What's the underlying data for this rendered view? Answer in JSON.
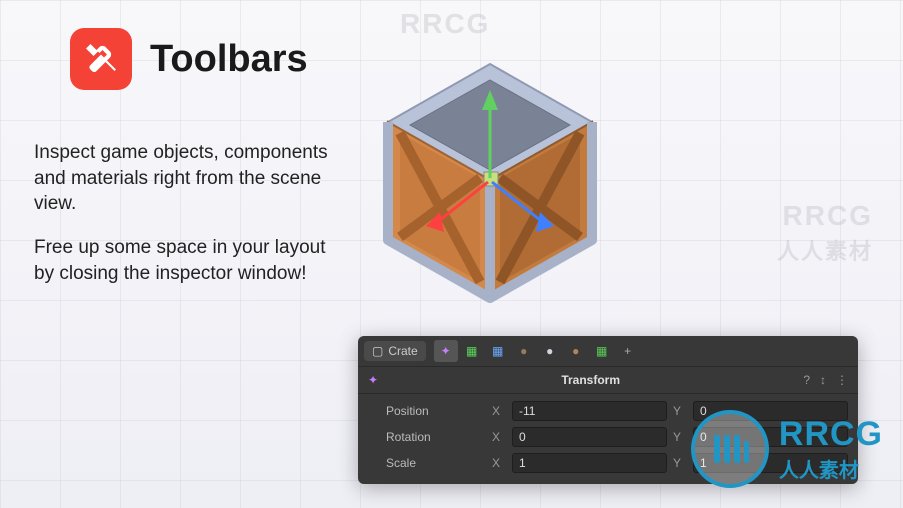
{
  "header": {
    "title": "Toolbars",
    "icon_name": "tools-icon"
  },
  "description": {
    "p1": "Inspect game objects, components and materials right from the scene view.",
    "p2": "Free up some space in your layout by closing the inspector window!"
  },
  "watermarks": {
    "label": "RRCG",
    "sub": "人人素材"
  },
  "scene": {
    "object_name": "Crate",
    "gizmo": {
      "x_color": "#ff4040",
      "y_color": "#60d060",
      "z_color": "#4080ff"
    }
  },
  "toolbar": {
    "buttons": [
      {
        "name": "transform-tool",
        "glyph": "✦",
        "color": "#c77dff",
        "selected": true
      },
      {
        "name": "grid-tool-1",
        "glyph": "▦",
        "color": "#5bd65b"
      },
      {
        "name": "grid-tool-2",
        "glyph": "▦",
        "color": "#6aa8ff"
      },
      {
        "name": "sphere-tool-1",
        "glyph": "●",
        "color": "#9a7a5a"
      },
      {
        "name": "sphere-tool-2",
        "glyph": "●",
        "color": "#cfd4e0"
      },
      {
        "name": "sphere-tool-3",
        "glyph": "●",
        "color": "#b0855a"
      },
      {
        "name": "grid-tool-3",
        "glyph": "▦",
        "color": "#58cc58"
      },
      {
        "name": "add-tool",
        "glyph": "+",
        "color": "#aaa"
      }
    ]
  },
  "inspector": {
    "component_title": "Transform",
    "help_icon": "?",
    "reset_icon": "↕",
    "menu_icon": "⋮",
    "axis_icon_color": "#c77dff",
    "properties": [
      {
        "label": "Position",
        "x_label": "X",
        "x_value": "-11",
        "y_label": "Y",
        "y_value": "0"
      },
      {
        "label": "Rotation",
        "x_label": "X",
        "x_value": "0",
        "y_label": "Y",
        "y_value": "0"
      },
      {
        "label": "Scale",
        "x_label": "X",
        "x_value": "1",
        "y_label": "Y",
        "y_value": "1"
      }
    ]
  },
  "brand": {
    "name": "RRCG",
    "tagline": "人人素材"
  }
}
